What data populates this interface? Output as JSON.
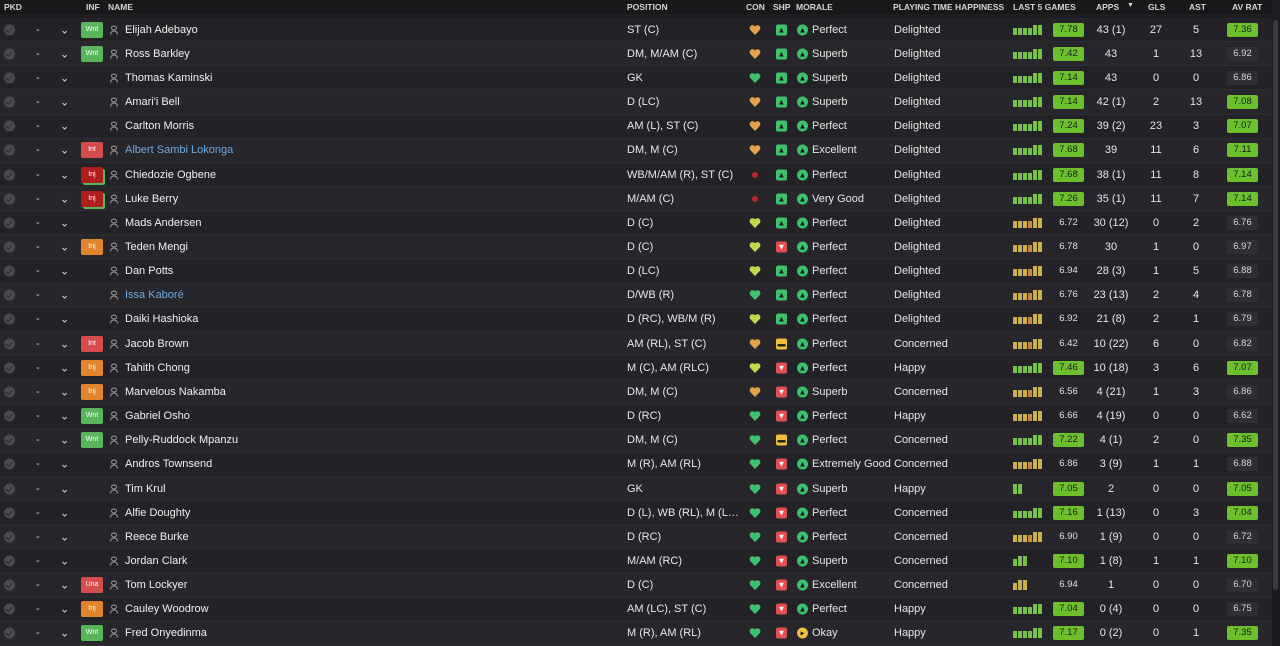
{
  "columns": {
    "pkd": "PKD",
    "inf": "INF",
    "name": "NAME",
    "position": "POSITION",
    "con": "CON",
    "shp": "SHP",
    "morale": "MORALE",
    "pth": "PLAYING TIME HAPPINESS",
    "last5": "LAST 5 GAMES",
    "apps": "APPS",
    "apps_sort": "▼",
    "gls": "GLS",
    "ast": "AST",
    "avrat": "AV RAT"
  },
  "colors": {
    "wnt_badge": "#58b65a",
    "int_badge": "#d64c4c",
    "inj_badge": "#e2842b",
    "rating_high": "#6cc02e",
    "link_name": "#6ea8de"
  },
  "players": [
    {
      "pkd": "-",
      "inf": "Wnt",
      "inf_type": "wnt",
      "name": "Elijah Adebayo",
      "link": false,
      "position": "ST (C)",
      "con": "heart-orange",
      "shp": "good",
      "morale_icon": "good",
      "morale": "Perfect",
      "pth": "Delighted",
      "form": "gggggg",
      "last5": "7.78",
      "l5hi": true,
      "apps": "43 (1)",
      "gls": "27",
      "ast": "5",
      "avrat": "7.36",
      "avhi": true
    },
    {
      "pkd": "-",
      "inf": "Wnt",
      "inf_type": "wnt",
      "name": "Ross Barkley",
      "link": false,
      "position": "DM, M/AM (C)",
      "con": "heart-orange",
      "shp": "good",
      "morale_icon": "good",
      "morale": "Superb",
      "pth": "Delighted",
      "form": "gggggg",
      "last5": "7.42",
      "l5hi": true,
      "apps": "43",
      "gls": "1",
      "ast": "13",
      "avrat": "6.92",
      "avhi": false
    },
    {
      "pkd": "-",
      "inf": "",
      "inf_type": "",
      "name": "Thomas Kaminski",
      "link": false,
      "position": "GK",
      "con": "heart-green",
      "shp": "good",
      "morale_icon": "good",
      "morale": "Superb",
      "pth": "Delighted",
      "form": "gggggg",
      "last5": "7.14",
      "l5hi": true,
      "apps": "43",
      "gls": "0",
      "ast": "0",
      "avrat": "6.86",
      "avhi": false
    },
    {
      "pkd": "-",
      "inf": "",
      "inf_type": "",
      "name": "Amari'i Bell",
      "link": false,
      "position": "D (LC)",
      "con": "heart-orange",
      "shp": "good",
      "morale_icon": "good",
      "morale": "Superb",
      "pth": "Delighted",
      "form": "gggggg",
      "last5": "7.14",
      "l5hi": true,
      "apps": "42 (1)",
      "gls": "2",
      "ast": "13",
      "avrat": "7.08",
      "avhi": true
    },
    {
      "pkd": "-",
      "inf": "",
      "inf_type": "",
      "name": "Carlton Morris",
      "link": false,
      "position": "AM (L), ST (C)",
      "con": "heart-orange",
      "shp": "good",
      "morale_icon": "good",
      "morale": "Perfect",
      "pth": "Delighted",
      "form": "gggggg",
      "last5": "7.24",
      "l5hi": true,
      "apps": "39 (2)",
      "gls": "23",
      "ast": "3",
      "avrat": "7.07",
      "avhi": true
    },
    {
      "pkd": "-",
      "inf": "Int",
      "inf_type": "int",
      "name": "Albert Sambi Lokonga",
      "link": true,
      "position": "DM, M (C)",
      "con": "heart-orange",
      "shp": "good",
      "morale_icon": "good",
      "morale": "Excellent",
      "pth": "Delighted",
      "form": "gggggg",
      "last5": "7.68",
      "l5hi": true,
      "apps": "39",
      "gls": "11",
      "ast": "6",
      "avrat": "7.11",
      "avhi": true
    },
    {
      "pkd": "-",
      "inf": "Inj",
      "inf_type": "inj-red",
      "name": "Chiedozie Ogbene",
      "link": false,
      "position": "WB/M/AM (R), ST (C)",
      "con": "injury",
      "shp": "good",
      "morale_icon": "good",
      "morale": "Perfect",
      "pth": "Delighted",
      "form": "gggggg",
      "last5": "7.68",
      "l5hi": true,
      "apps": "38 (1)",
      "gls": "11",
      "ast": "8",
      "avrat": "7.14",
      "avhi": true
    },
    {
      "pkd": "-",
      "inf": "Inj",
      "inf_type": "inj-red",
      "name": "Luke Berry",
      "link": false,
      "position": "M/AM (C)",
      "con": "injury",
      "shp": "good",
      "morale_icon": "good",
      "morale": "Very Good",
      "pth": "Delighted",
      "form": "gggggg",
      "last5": "7.26",
      "l5hi": true,
      "apps": "35 (1)",
      "gls": "11",
      "ast": "7",
      "avrat": "7.14",
      "avhi": true
    },
    {
      "pkd": "-",
      "inf": "",
      "inf_type": "",
      "name": "Mads Andersen",
      "link": false,
      "position": "D (C)",
      "con": "heart-yellow",
      "shp": "good",
      "morale_icon": "good",
      "morale": "Perfect",
      "pth": "Delighted",
      "form": "yyyoyy",
      "last5": "6.72",
      "l5hi": false,
      "apps": "30 (12)",
      "gls": "0",
      "ast": "2",
      "avrat": "6.76",
      "avhi": false
    },
    {
      "pkd": "-",
      "inf": "Inj",
      "inf_type": "inj",
      "name": "Teden Mengi",
      "link": false,
      "position": "D (C)",
      "con": "heart-yellow",
      "shp": "bad",
      "morale_icon": "good",
      "morale": "Perfect",
      "pth": "Delighted",
      "form": "yyyoyy",
      "last5": "6.78",
      "l5hi": false,
      "apps": "30",
      "gls": "1",
      "ast": "0",
      "avrat": "6.97",
      "avhi": false
    },
    {
      "pkd": "-",
      "inf": "",
      "inf_type": "",
      "name": "Dan Potts",
      "link": false,
      "position": "D (LC)",
      "con": "heart-yellow",
      "shp": "good",
      "morale_icon": "good",
      "morale": "Perfect",
      "pth": "Delighted",
      "form": "yyyoyy",
      "last5": "6.94",
      "l5hi": false,
      "apps": "28 (3)",
      "gls": "1",
      "ast": "5",
      "avrat": "6.88",
      "avhi": false
    },
    {
      "pkd": "-",
      "inf": "",
      "inf_type": "",
      "name": "Issa Kaboré",
      "link": true,
      "position": "D/WB (R)",
      "con": "heart-green",
      "shp": "good",
      "morale_icon": "good",
      "morale": "Perfect",
      "pth": "Delighted",
      "form": "yyyoyy",
      "last5": "6.76",
      "l5hi": false,
      "apps": "23 (13)",
      "gls": "2",
      "ast": "4",
      "avrat": "6.78",
      "avhi": false
    },
    {
      "pkd": "-",
      "inf": "",
      "inf_type": "",
      "name": "Daiki Hashioka",
      "link": false,
      "position": "D (RC), WB/M (R)",
      "con": "heart-yellow",
      "shp": "good",
      "morale_icon": "good",
      "morale": "Perfect",
      "pth": "Delighted",
      "form": "yyyoyy",
      "last5": "6.92",
      "l5hi": false,
      "apps": "21 (8)",
      "gls": "2",
      "ast": "1",
      "avrat": "6.79",
      "avhi": false
    },
    {
      "pkd": "-",
      "inf": "Int",
      "inf_type": "int",
      "name": "Jacob Brown",
      "link": false,
      "position": "AM (RL), ST (C)",
      "con": "heart-orange",
      "shp": "mid",
      "morale_icon": "good",
      "morale": "Perfect",
      "pth": "Concerned",
      "form": "yyyoyy",
      "last5": "6.42",
      "l5hi": false,
      "apps": "10 (22)",
      "gls": "6",
      "ast": "0",
      "avrat": "6.82",
      "avhi": false
    },
    {
      "pkd": "-",
      "inf": "Inj",
      "inf_type": "inj",
      "name": "Tahith Chong",
      "link": false,
      "position": "M (C), AM (RLC)",
      "con": "heart-yellow",
      "shp": "bad",
      "morale_icon": "good",
      "morale": "Perfect",
      "pth": "Happy",
      "form": "gggggg",
      "last5": "7.46",
      "l5hi": true,
      "apps": "10 (18)",
      "gls": "3",
      "ast": "6",
      "avrat": "7.07",
      "avhi": true
    },
    {
      "pkd": "-",
      "inf": "Inj",
      "inf_type": "inj",
      "name": "Marvelous Nakamba",
      "link": false,
      "position": "DM, M (C)",
      "con": "heart-orange",
      "shp": "bad",
      "morale_icon": "good",
      "morale": "Superb",
      "pth": "Concerned",
      "form": "yyyoyy",
      "last5": "6.56",
      "l5hi": false,
      "apps": "4 (21)",
      "gls": "1",
      "ast": "3",
      "avrat": "6.86",
      "avhi": false
    },
    {
      "pkd": "-",
      "inf": "Wnt",
      "inf_type": "wnt",
      "name": "Gabriel Osho",
      "link": false,
      "position": "D (RC)",
      "con": "heart-green",
      "shp": "bad",
      "morale_icon": "good",
      "morale": "Perfect",
      "pth": "Happy",
      "form": "yyyoyy",
      "last5": "6.66",
      "l5hi": false,
      "apps": "4 (19)",
      "gls": "0",
      "ast": "0",
      "avrat": "6.62",
      "avhi": false
    },
    {
      "pkd": "-",
      "inf": "Wnt",
      "inf_type": "wnt",
      "name": "Pelly-Ruddock Mpanzu",
      "link": false,
      "position": "DM, M (C)",
      "con": "heart-green",
      "shp": "mid",
      "morale_icon": "good",
      "morale": "Perfect",
      "pth": "Concerned",
      "form": "gggggg",
      "last5": "7.22",
      "l5hi": true,
      "apps": "4 (1)",
      "gls": "2",
      "ast": "0",
      "avrat": "7.35",
      "avhi": true
    },
    {
      "pkd": "-",
      "inf": "",
      "inf_type": "",
      "name": "Andros Townsend",
      "link": false,
      "position": "M (R), AM (RL)",
      "con": "heart-green",
      "shp": "bad",
      "morale_icon": "good",
      "morale": "Extremely Good",
      "pth": "Concerned",
      "form": "yyyoyy",
      "last5": "6.86",
      "l5hi": false,
      "apps": "3 (9)",
      "gls": "1",
      "ast": "1",
      "avrat": "6.88",
      "avhi": false
    },
    {
      "pkd": "-",
      "inf": "",
      "inf_type": "",
      "name": "Tim Krul",
      "link": false,
      "position": "GK",
      "con": "heart-green",
      "shp": "bad",
      "morale_icon": "good",
      "morale": "Superb",
      "pth": "Happy",
      "form": "gg",
      "last5": "7.05",
      "l5hi": true,
      "apps": "2",
      "gls": "0",
      "ast": "0",
      "avrat": "7.05",
      "avhi": true
    },
    {
      "pkd": "-",
      "inf": "",
      "inf_type": "",
      "name": "Alfie Doughty",
      "link": false,
      "position": "D (L), WB (RL), M (L),...",
      "con": "heart-green",
      "shp": "bad",
      "morale_icon": "good",
      "morale": "Perfect",
      "pth": "Concerned",
      "form": "gggggg",
      "last5": "7.16",
      "l5hi": true,
      "apps": "1 (13)",
      "gls": "0",
      "ast": "3",
      "avrat": "7.04",
      "avhi": true
    },
    {
      "pkd": "-",
      "inf": "",
      "inf_type": "",
      "name": "Reece Burke",
      "link": false,
      "position": "D (RC)",
      "con": "heart-green",
      "shp": "bad",
      "morale_icon": "good",
      "morale": "Perfect",
      "pth": "Concerned",
      "form": "yyyoyy",
      "last5": "6.90",
      "l5hi": false,
      "apps": "1 (9)",
      "gls": "0",
      "ast": "0",
      "avrat": "6.72",
      "avhi": false
    },
    {
      "pkd": "-",
      "inf": "",
      "inf_type": "",
      "name": "Jordan Clark",
      "link": false,
      "position": "M/AM (RC)",
      "con": "heart-green",
      "shp": "bad",
      "morale_icon": "good",
      "morale": "Superb",
      "pth": "Concerned",
      "form": "ggg",
      "last5": "7.10",
      "l5hi": true,
      "apps": "1 (8)",
      "gls": "1",
      "ast": "1",
      "avrat": "7.10",
      "avhi": true
    },
    {
      "pkd": "-",
      "inf": "Una",
      "inf_type": "una",
      "name": "Tom Lockyer",
      "link": false,
      "position": "D (C)",
      "con": "heart-green",
      "shp": "bad",
      "morale_icon": "good",
      "morale": "Excellent",
      "pth": "Concerned",
      "form": "yyy",
      "last5": "6.94",
      "l5hi": false,
      "apps": "1",
      "gls": "0",
      "ast": "0",
      "avrat": "6.70",
      "avhi": false
    },
    {
      "pkd": "-",
      "inf": "Inj",
      "inf_type": "inj",
      "name": "Cauley Woodrow",
      "link": false,
      "position": "AM (LC), ST (C)",
      "con": "heart-green",
      "shp": "bad",
      "morale_icon": "good",
      "morale": "Perfect",
      "pth": "Happy",
      "form": "gggggg",
      "last5": "7.04",
      "l5hi": true,
      "apps": "0 (4)",
      "gls": "0",
      "ast": "0",
      "avrat": "6.75",
      "avhi": false
    },
    {
      "pkd": "-",
      "inf": "Wnt",
      "inf_type": "wnt",
      "name": "Fred Onyedinma",
      "link": false,
      "position": "M (R), AM (RL)",
      "con": "heart-green",
      "shp": "bad",
      "morale_icon": "ok",
      "morale": "Okay",
      "pth": "Happy",
      "form": "gggggg",
      "last5": "7.17",
      "l5hi": true,
      "apps": "0 (2)",
      "gls": "0",
      "ast": "1",
      "avrat": "7.35",
      "avhi": true
    }
  ]
}
